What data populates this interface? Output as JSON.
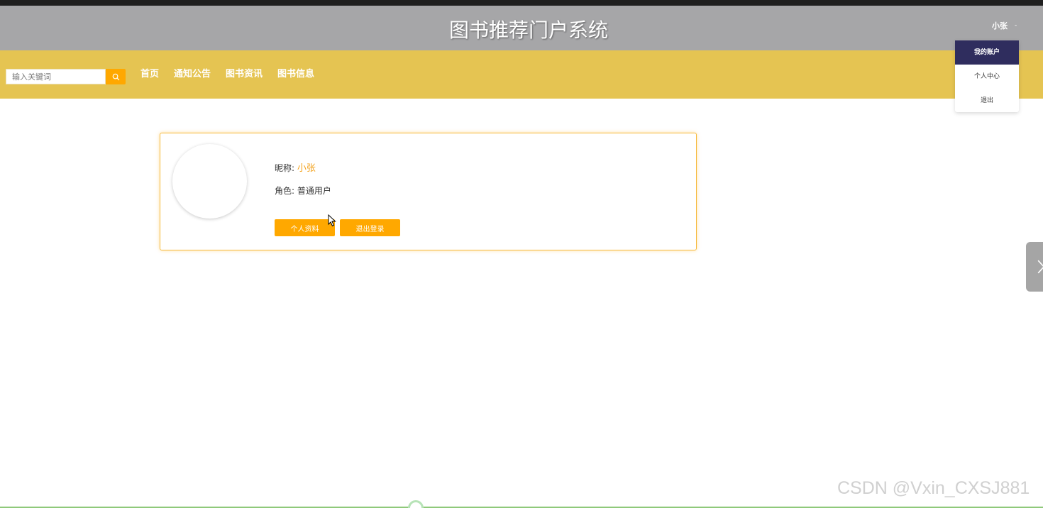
{
  "header": {
    "site_title": "图书推荐门户系统",
    "user_name": "小张",
    "caret": "-"
  },
  "navbar": {
    "search_placeholder": "输入关键词",
    "items": [
      "首页",
      "通知公告",
      "图书资讯",
      "图书信息"
    ]
  },
  "dropdown": {
    "items": [
      "我的账户",
      "个人中心",
      "退出"
    ]
  },
  "profile": {
    "nick_label": "昵称:",
    "nick_value": "小张",
    "role_label": "角色:",
    "role_value": "普通用户",
    "profile_button": "个人资料",
    "logout_button": "退出登录"
  },
  "watermark": "CSDN @Vxin_CXSJ881",
  "colors": {
    "header_bg": "#a6a6a8",
    "navbar_bg": "#e5c452",
    "accent": "#ffa800",
    "dropdown_active": "#2f2d5e"
  }
}
